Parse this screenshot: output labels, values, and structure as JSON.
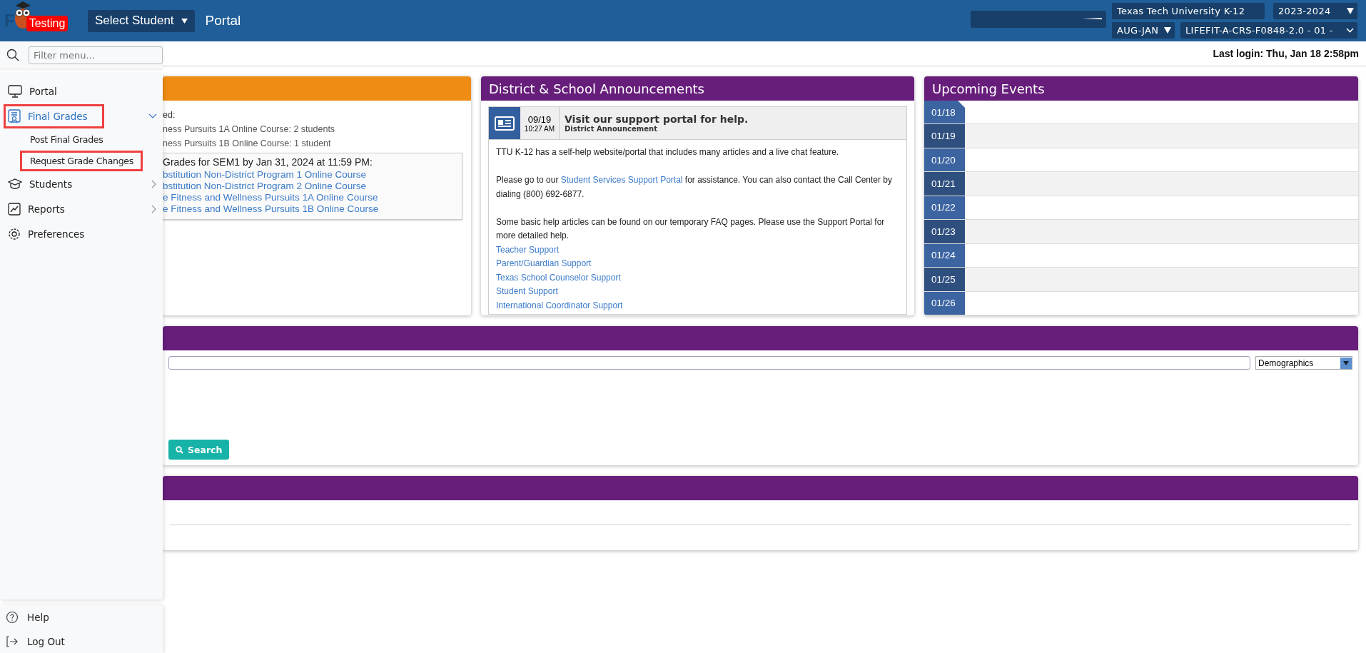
{
  "header": {
    "logo_letter": "F",
    "badge": "Testing",
    "student_select": "Select Student",
    "page_title": "Portal",
    "selects": [
      {
        "value": "Texas Tech University K-12",
        "kind": "field"
      },
      {
        "value": "2023-2024",
        "kind": "dropdown"
      },
      {
        "value": "AUG-JAN",
        "kind": "dropdown"
      },
      {
        "value": "LIFEFIT-A-CRS-F0848-2.0 - 01 -",
        "kind": "chevron"
      }
    ]
  },
  "last_login": "Last login: Thu, Jan 18 2:58pm",
  "sidebar": {
    "filter": {
      "placeholder": "Filter menu..."
    },
    "items": [
      {
        "label": "Portal",
        "kind": "link",
        "selected": false,
        "annotated": false
      },
      {
        "label": "Final Grades",
        "kind": "group",
        "expanded": true,
        "selected": true,
        "annotated": true,
        "children": [
          {
            "label": "Post Final Grades",
            "annotated": false
          },
          {
            "label": "Request Grade Changes",
            "annotated": true
          }
        ]
      },
      {
        "label": "Students",
        "kind": "group",
        "expanded": false,
        "selected": false,
        "annotated": false
      },
      {
        "label": "Reports",
        "kind": "group",
        "expanded": false,
        "selected": false,
        "annotated": false
      },
      {
        "label": "Preferences",
        "kind": "link",
        "selected": false,
        "annotated": false
      }
    ],
    "footer": [
      {
        "label": "Help"
      },
      {
        "label": "Log Out"
      }
    ]
  },
  "notice_panel": {
    "lines": [
      "ed:",
      "ness Pursuits 1A Online Course: 2 students",
      "ness Pursuits 1B Online Course: 1 student"
    ],
    "deadline": {
      "heading": "Grades for SEM1 by Jan 31, 2024 at 11:59 PM:",
      "links": [
        "bstitution Non-District Program 1 Online Course",
        "bstitution Non-District Program 2 Online Course",
        "e Fitness and Wellness Pursuits 1A Online Course",
        "e Fitness and Wellness Pursuits 1B Online Course"
      ]
    }
  },
  "announcements": {
    "title": "District & School Announcements",
    "item": {
      "date": "09/19",
      "time": "10:27 AM",
      "title": "Visit our support portal for help.",
      "subtitle": "District Announcement",
      "paragraphs": [
        {
          "before": "TTU K-12 has a self-help website/portal that includes many articles and a live chat feature."
        },
        {
          "before": "Please go to our ",
          "link": "Student Services Support Portal",
          "after": " for assistance. You can also contact the Call Center by dialing (800) 692-6877."
        },
        {
          "before": "Some basic help articles can be found on our temporary FAQ pages. Please use the Support Portal for more detailed help."
        }
      ],
      "links": [
        "Teacher Support",
        "Parent/Guardian Support",
        "Texas School Counselor Support",
        "Student Support",
        "International Coordinator Support"
      ]
    }
  },
  "events": {
    "title": "Upcoming Events",
    "days": [
      {
        "date": "01/18",
        "today": true
      },
      {
        "date": "01/19",
        "today": false
      },
      {
        "date": "01/20",
        "today": false
      },
      {
        "date": "01/21",
        "today": false
      },
      {
        "date": "01/22",
        "today": false
      },
      {
        "date": "01/23",
        "today": false
      },
      {
        "date": "01/24",
        "today": false
      },
      {
        "date": "01/25",
        "today": false
      },
      {
        "date": "01/26",
        "today": false
      }
    ]
  },
  "search_panel": {
    "category": "Demographics",
    "button": "Search"
  }
}
